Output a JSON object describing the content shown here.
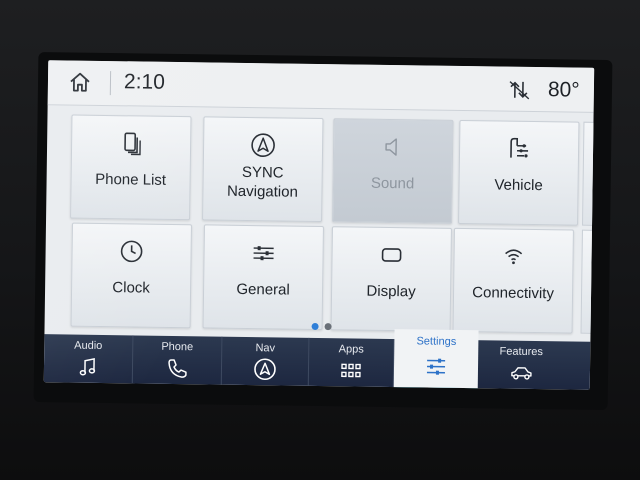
{
  "status_bar": {
    "time": "2:10",
    "temperature": "80°",
    "icons": [
      "home-icon",
      "signal-arrows-icon"
    ]
  },
  "tiles": [
    {
      "label": "Phone List",
      "icon": "phone-list-icon",
      "enabled": true
    },
    {
      "label": "SYNC\nNavigation",
      "icon": "navigation-icon",
      "enabled": true
    },
    {
      "label": "Sound",
      "icon": "speaker-icon",
      "enabled": false
    },
    {
      "label": "Vehicle",
      "icon": "vehicle-settings-icon",
      "enabled": true
    },
    {
      "label": "Clock",
      "icon": "clock-icon",
      "enabled": true
    },
    {
      "label": "General",
      "icon": "sliders-icon",
      "enabled": true
    },
    {
      "label": "Display",
      "icon": "display-icon",
      "enabled": true
    },
    {
      "label": "Connectivity",
      "icon": "wifi-icon",
      "enabled": true
    }
  ],
  "pagination": {
    "pages": 2,
    "current": 1
  },
  "nav": [
    {
      "label": "Audio",
      "icon": "music-note-icon",
      "active": false
    },
    {
      "label": "Phone",
      "icon": "phone-icon",
      "active": false
    },
    {
      "label": "Nav",
      "icon": "nav-arrow-icon",
      "active": false
    },
    {
      "label": "Apps",
      "icon": "apps-grid-icon",
      "active": false
    },
    {
      "label": "Settings",
      "icon": "settings-sliders-icon",
      "active": true
    },
    {
      "label": "Features",
      "icon": "car-features-icon",
      "active": false
    }
  ],
  "colors": {
    "accent": "#2f7fd8",
    "nav_background": "#1d2740",
    "active_underline": "#23c2d6",
    "screen_background": "#e9ecef"
  }
}
